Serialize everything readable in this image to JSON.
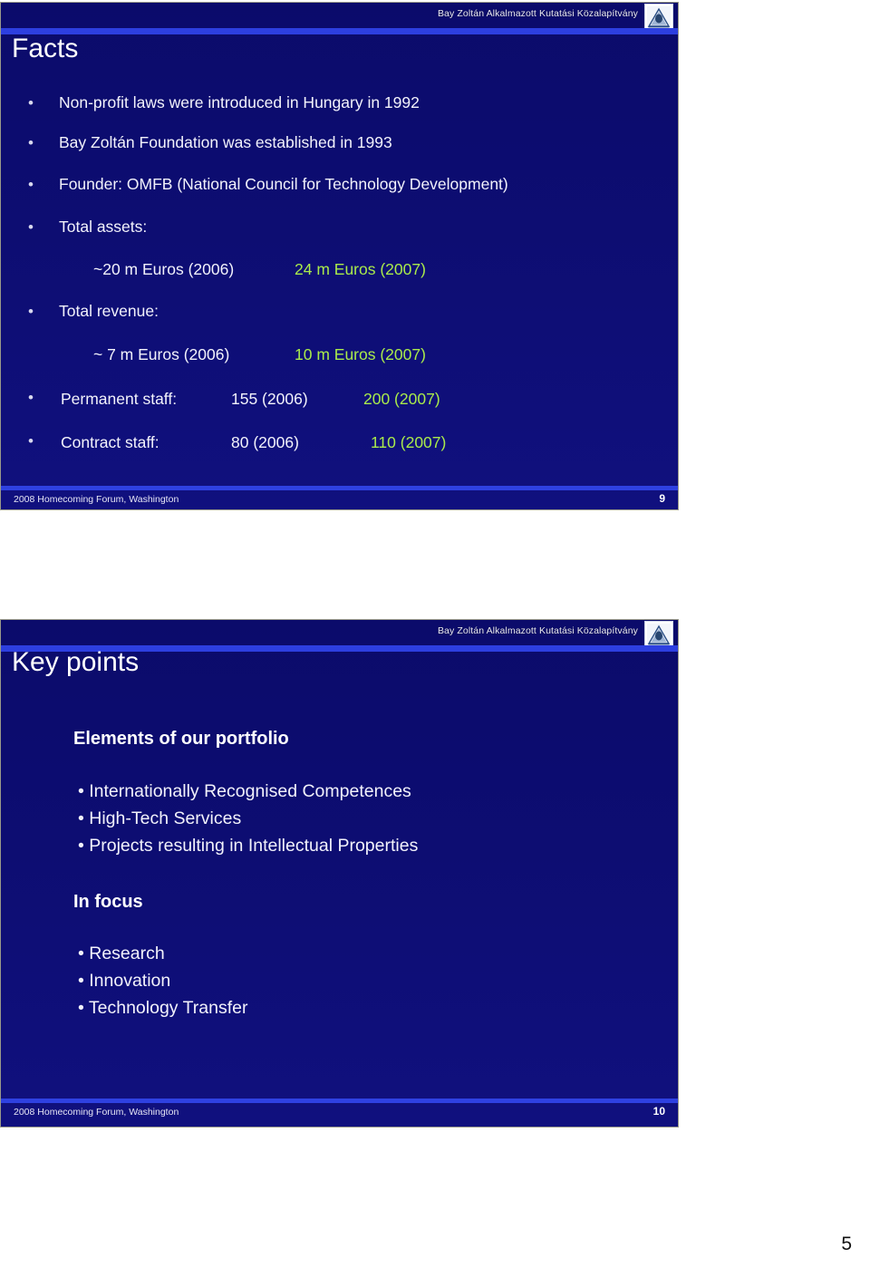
{
  "document": {
    "page_number": "5"
  },
  "colors": {
    "slide_bg": "#0c0c6e",
    "accent_bar": "#2d3fe0",
    "text": "#f2f2fb",
    "highlight_2007": "#a9ea4b"
  },
  "slides": [
    {
      "title": "Facts",
      "header": {
        "org_name": "Bay Zoltán Alkalmazott Kutatási Közalapítvány",
        "logo_icon": "pyramid-logo-icon"
      },
      "bullets": [
        "Non-profit  laws were introduced in Hungary in 1992",
        "Bay Zoltán Foundation was established in 1993",
        "Founder: OMFB (National Council for Technology Development)",
        "Total assets:",
        "Total revenue:"
      ],
      "assets_values": {
        "y2006": "~20 m Euros (2006)",
        "y2007": "24 m Euros (2007)"
      },
      "revenue_values": {
        "y2006": "~ 7 m Euros (2006)",
        "y2007": "10 m Euros (2007)"
      },
      "staff_rows": [
        {
          "label": "Permanent staff:",
          "y2006": "155 (2006)",
          "y2007": "200 (2007)"
        },
        {
          "label": "Contract staff:",
          "y2006": "80 (2006)",
          "y2007": "110 (2007)"
        }
      ],
      "footer": {
        "text": "2008 Homecoming Forum, Washington",
        "page": "9"
      }
    },
    {
      "title": "Key points",
      "header": {
        "org_name": "Bay Zoltán Alkalmazott Kutatási Közalapítvány",
        "logo_icon": "pyramid-logo-icon"
      },
      "sections": [
        {
          "heading": "Elements of our portfolio",
          "items": [
            "• Internationally Recognised Competences",
            "• High-Tech Services",
            "• Projects resulting in Intellectual Properties"
          ]
        },
        {
          "heading": "In focus",
          "items": [
            "• Research",
            "• Innovation",
            "• Technology Transfer"
          ]
        }
      ],
      "footer": {
        "text": "2008 Homecoming Forum, Washington",
        "page": "10"
      }
    }
  ]
}
